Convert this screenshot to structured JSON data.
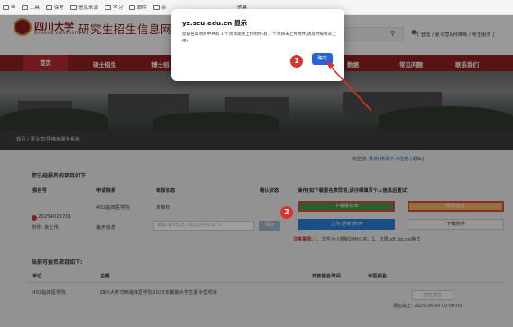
{
  "bookmarks": [
    "ai",
    "工具",
    "保考",
    "信息来源",
    "学习",
    "邮件",
    "杂"
  ],
  "bookmark_more": "他暑",
  "header": {
    "logo_cn": "四川大学",
    "logo_en": "SICHUAN UNIVERSITY",
    "site_title": "研究生招生信息网",
    "user_link": "[ 登陆 / 夏令营&预推免 / 考生服务 ]"
  },
  "nav": [
    "首页",
    "硕士招生",
    "博士招",
    "数据",
    "常见问题",
    "联系我们"
  ],
  "breadcrumb": "首页 / 夏令营/预推免服务系统",
  "welcome": {
    "prefix": "欢迎您:",
    "name": "陈俐",
    "change": "修改个人信息",
    "logout": "[退出]"
  },
  "registered": {
    "title": "您已经报名的项目如下",
    "headers": [
      "报名号",
      "申请院系",
      "审核状态",
      "确认状态",
      "操作(如下载报名表异常,请仔细填写个人信息后重试)"
    ],
    "reg_no": "20254021701",
    "attach_status": "附件: 未上传",
    "dept": "402临床医学院",
    "review": "未审核",
    "remark_label": "备用信息",
    "remark_placeholder": "请输入备用信息,不超过20字符,如\"下",
    "save": "保存",
    "download_form": "下载报名表",
    "edit_info": "修改信息",
    "upload": "上传(更新)附件",
    "download_attach": "下载附件",
    "note_label": "注意事项:",
    "note_text": "1、文件大小限制20M以内。2、仅限pdf,zip,rar格式"
  },
  "available": {
    "title": "当前可报名项目如下:",
    "headers": [
      "单位",
      "主题",
      "开放报名时间",
      "可否报名"
    ],
    "unit": "402临床医学院",
    "topic": "四川大学华西临床医学院2025年暑期大学生夏令营项目",
    "apply": "前往报名",
    "deadline": "报名截止: 2025-06-20 00:00:00"
  },
  "dialog": {
    "title": "yz.scu.edu.cn 显示",
    "message": "您报名的项目中共有 1 个项目需要上传附件,有 1 个项目未上传附件,请及时按要求上传!",
    "ok": "确定"
  },
  "markers": [
    "1",
    "2"
  ]
}
